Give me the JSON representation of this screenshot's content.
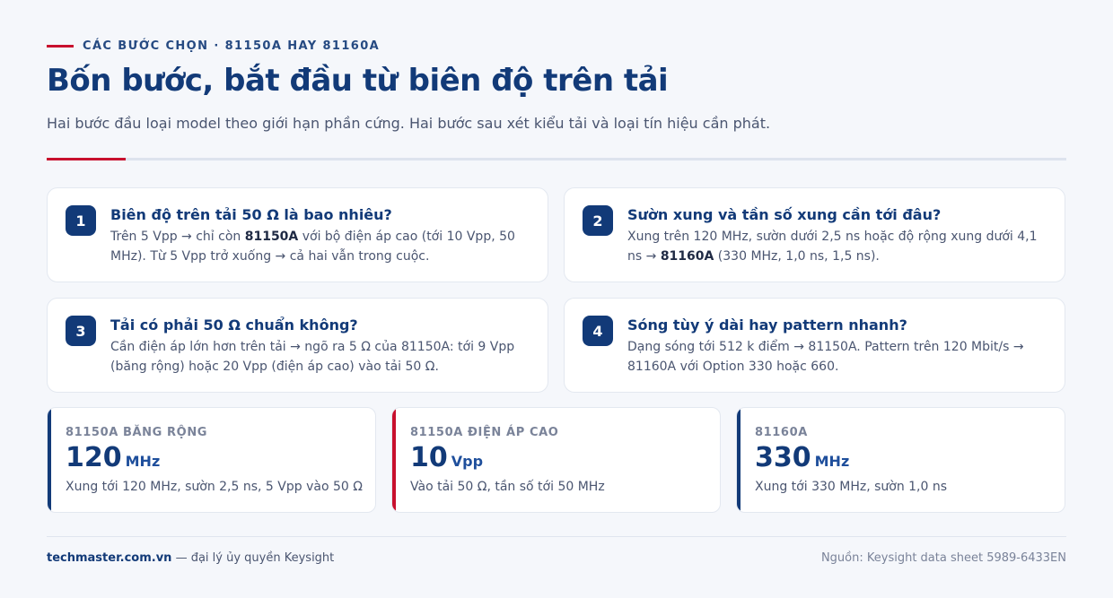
{
  "header": {
    "eyebrow": "CÁC BƯỚC CHỌN · 81150A HAY 81160A",
    "title": "Bốn bước, bắt đầu từ biên độ trên tải",
    "subtitle": "Hai bước đầu loại model theo giới hạn phần cứng. Hai bước sau xét kiểu tải và loại tín hiệu cần phát."
  },
  "steps": [
    {
      "number": "1",
      "question": "Biên độ trên tải 50 Ω là bao nhiêu?",
      "answer_pre": "Trên 5 Vpp → chỉ còn ",
      "answer_bold": "81150A",
      "answer_post": " với bộ điện áp cao (tới 10 Vpp, 50 MHz). Từ 5 Vpp trở xuống → cả hai vẫn trong cuộc."
    },
    {
      "number": "2",
      "question": "Sườn xung và tần số xung cần tới đâu?",
      "answer_pre": "Xung trên 120 MHz, sườn dưới 2,5 ns hoặc độ rộng xung dưới 4,1 ns → ",
      "answer_bold": "81160A",
      "answer_post": " (330 MHz, 1,0 ns, 1,5 ns)."
    },
    {
      "number": "3",
      "question": "Tải có phải 50 Ω chuẩn không?",
      "answer": "Cần điện áp lớn hơn trên tải → ngõ ra 5 Ω của 81150A: tới 9 Vpp (băng rộng) hoặc 20 Vpp (điện áp cao) vào tải 50 Ω."
    },
    {
      "number": "4",
      "question": "Sóng tùy ý dài hay pattern nhanh?",
      "answer": "Dạng sóng tới 512 k điểm → 81150A. Pattern trên 120 Mbit/s → 81160A với Option 330 hoặc 660."
    }
  ],
  "stats": [
    {
      "label": "81150A BĂNG RỘNG",
      "value": "120",
      "unit": "MHz",
      "desc": "Xung tới 120 MHz, sườn 2,5 ns, 5 Vpp vào 50 Ω",
      "accent": "#123a78"
    },
    {
      "label": "81150A ĐIỆN ÁP CAO",
      "value": "10",
      "unit": "Vpp",
      "desc": "Vào tải 50 Ω, tần số tới 50 MHz",
      "accent": "#c8102e"
    },
    {
      "label": "81160A",
      "value": "330",
      "unit": "MHz",
      "desc": "Xung tới 330 MHz, sườn 1,0 ns",
      "accent": "#123a78"
    }
  ],
  "footer": {
    "site": "techmaster.com.vn",
    "tagline": " — đại lý ủy quyền Keysight",
    "source": "Nguồn: Keysight data sheet 5989-6433EN"
  },
  "colors": {
    "brand_navy": "#123a78",
    "accent_red": "#c8102e",
    "background": "#f5f7fb"
  }
}
